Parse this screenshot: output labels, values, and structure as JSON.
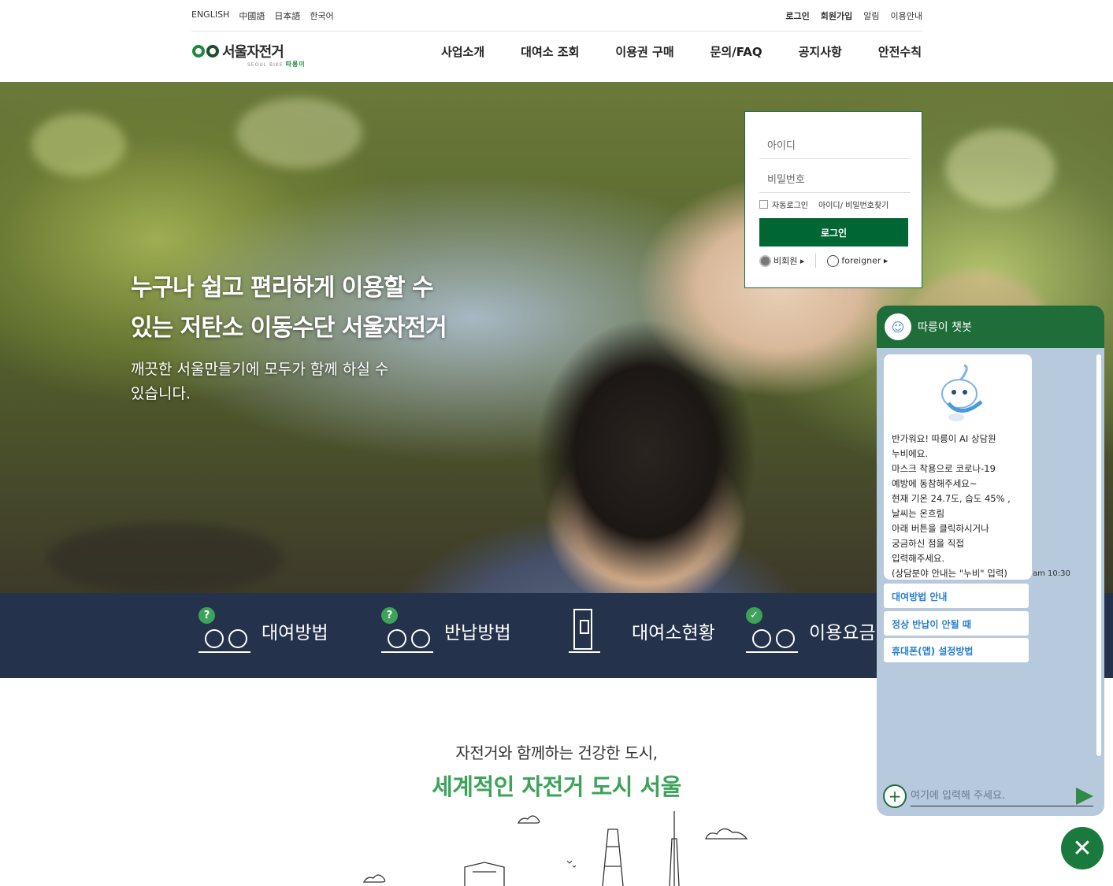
{
  "util": {
    "langs": [
      "ENGLISH",
      "中國語",
      "日本語",
      "한국어"
    ],
    "links": [
      "로그인",
      "회원가입",
      "알림",
      "이용안내"
    ]
  },
  "logo": {
    "main": "서울자전거",
    "sub": "SEOUL BIKE",
    "brand": "따릉이"
  },
  "nav": [
    "사업소개",
    "대여소 조회",
    "이용권 구매",
    "문의/FAQ",
    "공지사항",
    "안전수칙"
  ],
  "hero": {
    "headline1": "누구나 쉽고 편리하게 이용할 수",
    "headline2": "있는 저탄소 이동수단 서울자전거",
    "sub1": "깨끗한  서울만들기에  모두가 함께 하실 수",
    "sub2": "있습니다."
  },
  "login": {
    "id_placeholder": "아이디",
    "pw_placeholder": "비밀번호",
    "auto_login": "자동로그인",
    "find": "아이디/ 비밀번호찾기",
    "button": "로그인",
    "guest": "비회원",
    "foreigner": "foreigner"
  },
  "quick": [
    {
      "label": "대여방법",
      "badge": "?"
    },
    {
      "label": "반납방법",
      "badge": "?"
    },
    {
      "label": "대여소현황",
      "badge": ""
    },
    {
      "label": "이용요금",
      "badge": "✓"
    }
  ],
  "tagline": {
    "line1": "자전거와 함께하는 건강한 도시,",
    "line2": "세계적인 자전거 도시 서울"
  },
  "chat": {
    "title": "따릉이 챗봇",
    "message": [
      "반가워요! 따릉이 AI 상담원",
      "누비에요.",
      "마스크 착용으로 코로나-19",
      "예방에 동참해주세요~",
      "현재 기온 24.7도, 습도 45% ,",
      "날씨는 온흐림",
      "아래 버튼을 클릭하시거나",
      "궁금하신 점을 직접",
      "입력해주세요.",
      "(상담분야 안내는 \"누비\" 입력)"
    ],
    "time": "am 10:30",
    "options": [
      "대여방법 안내",
      "정상 반납이 안될 때",
      "휴대폰(앱) 설정방법"
    ],
    "input_placeholder": "여기에 입력해 주세요."
  },
  "colors": {
    "brand_green": "#006633",
    "accent_green": "#3ea35a",
    "quick_bar": "#24324b",
    "chat_bg": "#b7c9dc"
  }
}
